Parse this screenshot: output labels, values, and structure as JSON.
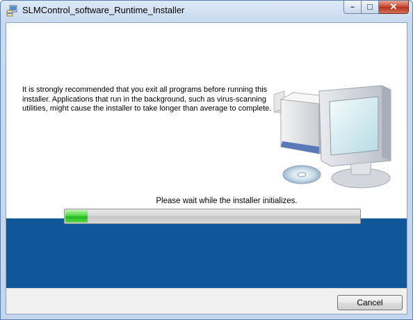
{
  "window": {
    "title": "SLMControl_software_Runtime_Installer",
    "controls": {
      "minimize_glyph": "━",
      "maximize_glyph": "☐",
      "close_glyph": "✕"
    }
  },
  "main": {
    "message": "It is strongly recommended that you exit all programs before running this installer. Applications that run in the background, such as virus-scanning utilities, might cause the installer to take longer than average to complete.",
    "illustration_icon": "computer-with-box-and-disc",
    "status": "Please wait while the installer initializes.",
    "progress_fraction": 0.08
  },
  "footer": {
    "cancel_label": "Cancel"
  },
  "colors": {
    "accent_band": "#10579a",
    "progress_green": "#21b81c"
  }
}
